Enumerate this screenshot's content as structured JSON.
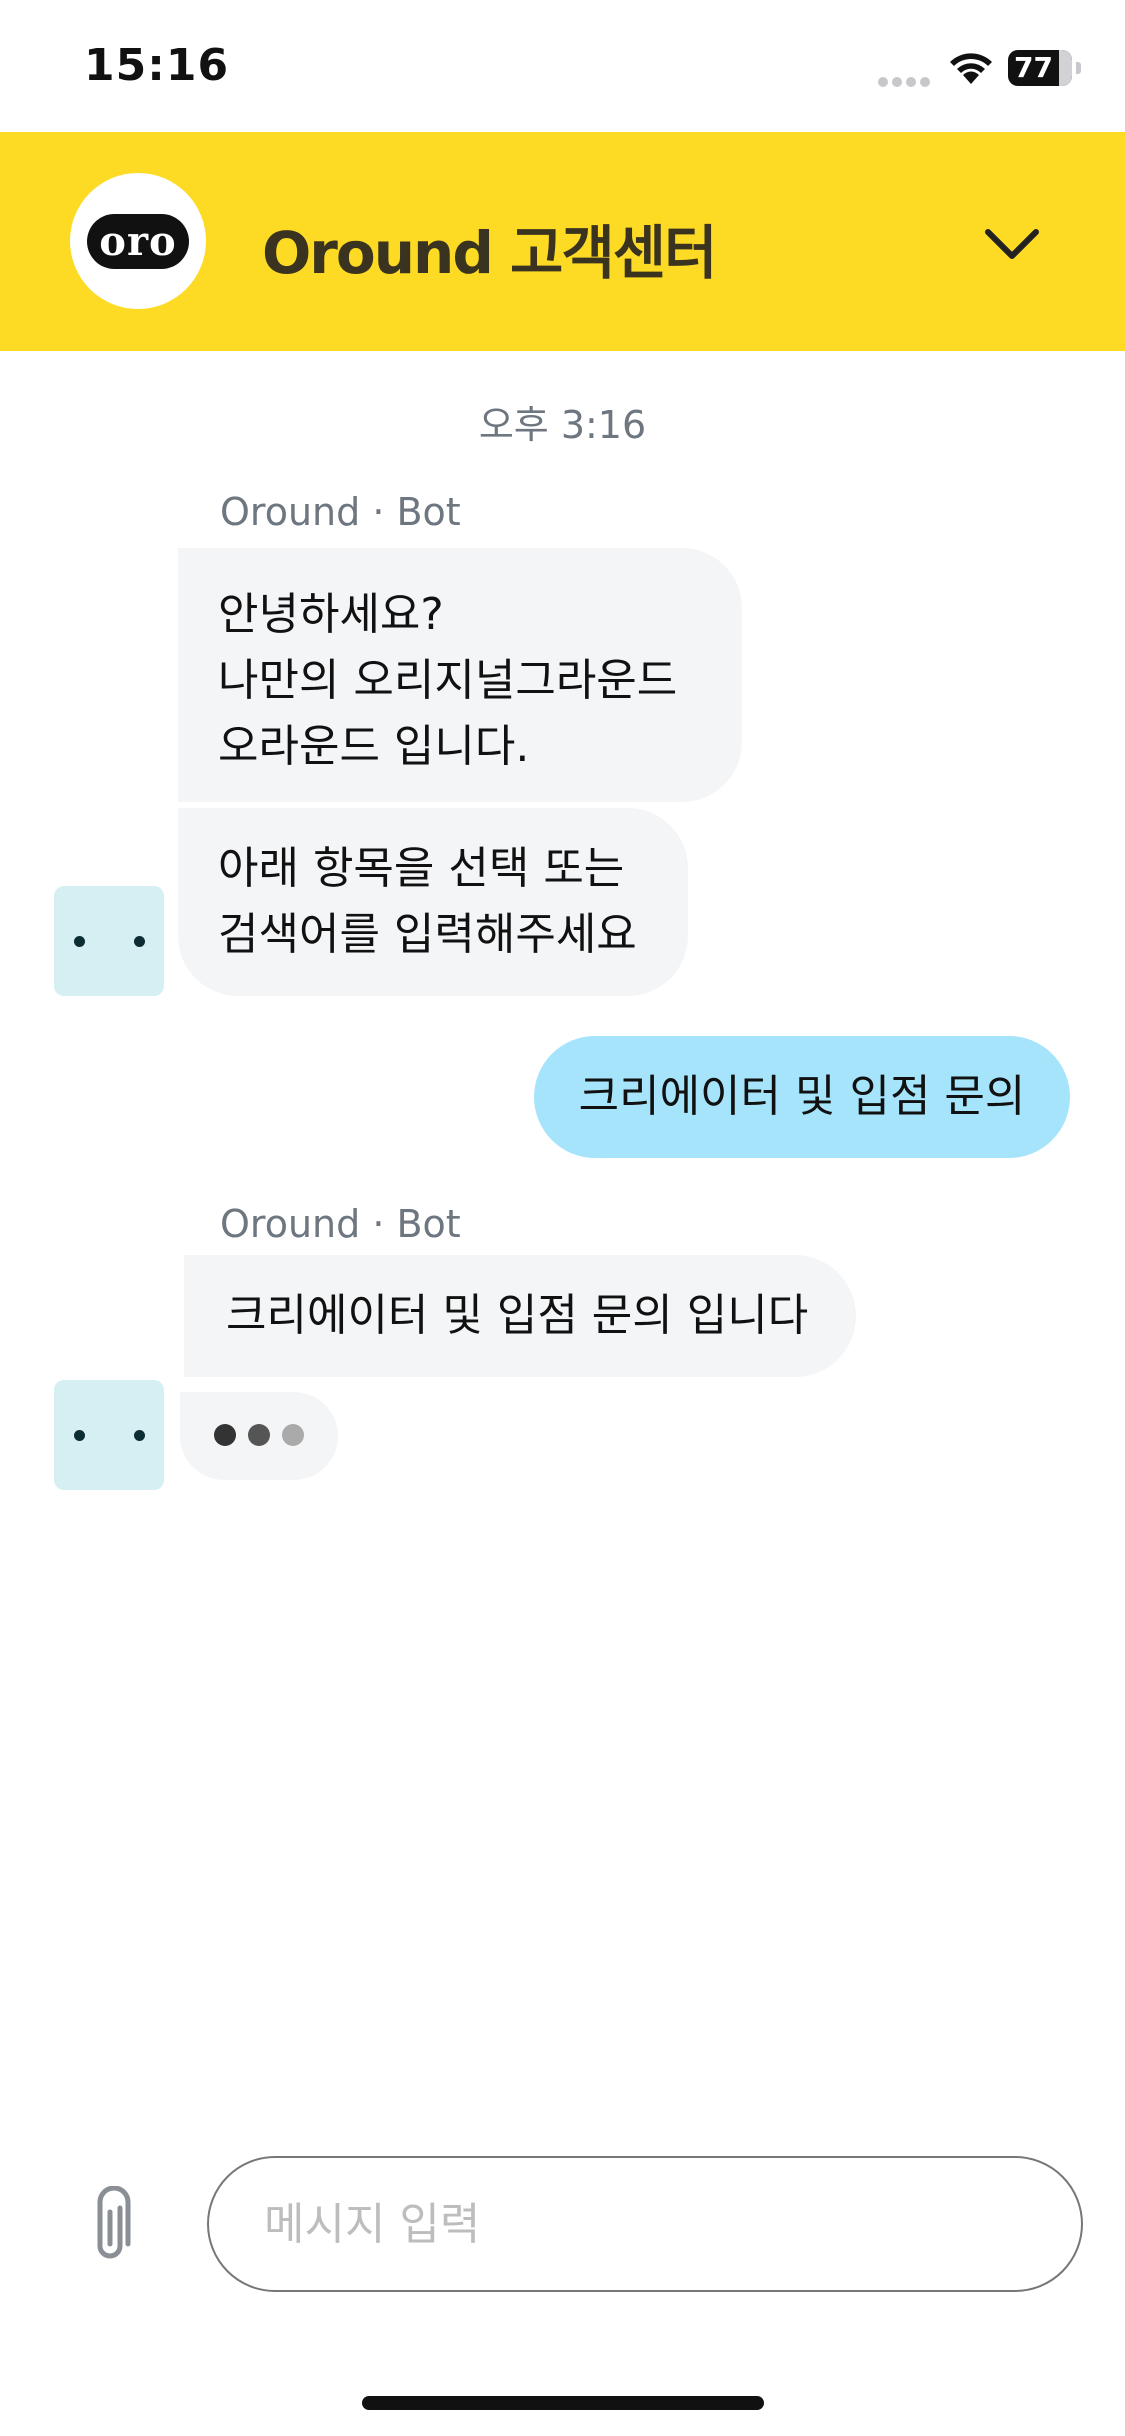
{
  "status_bar": {
    "time": "15:16",
    "battery": "77"
  },
  "header": {
    "logo_text": "oro",
    "title": "Oround 고객센터",
    "collapse_icon": "chevron-down-icon"
  },
  "chat": {
    "timestamp": "오후 3:16",
    "messages": [
      {
        "sender": "Oround · Bot",
        "bubbles": [
          "안녕하세요?\n나만의 오리지널그라운드\n오라운드 입니다.",
          "아래 항목을 선택 또는\n검색어를 입력해주세요"
        ]
      },
      {
        "user": "크리에이터 및 입점 문의"
      },
      {
        "sender": "Oround · Bot",
        "bubbles": [
          "크리에이터 및 입점 문의 입니다"
        ]
      }
    ]
  },
  "composer": {
    "placeholder": "메시지 입력",
    "attach_icon": "paperclip-icon"
  },
  "colors": {
    "header": "#fdda24",
    "user_bubble": "#a6e4fb",
    "bot_bubble": "#f4f5f7",
    "avatar": "#d6eff2"
  }
}
